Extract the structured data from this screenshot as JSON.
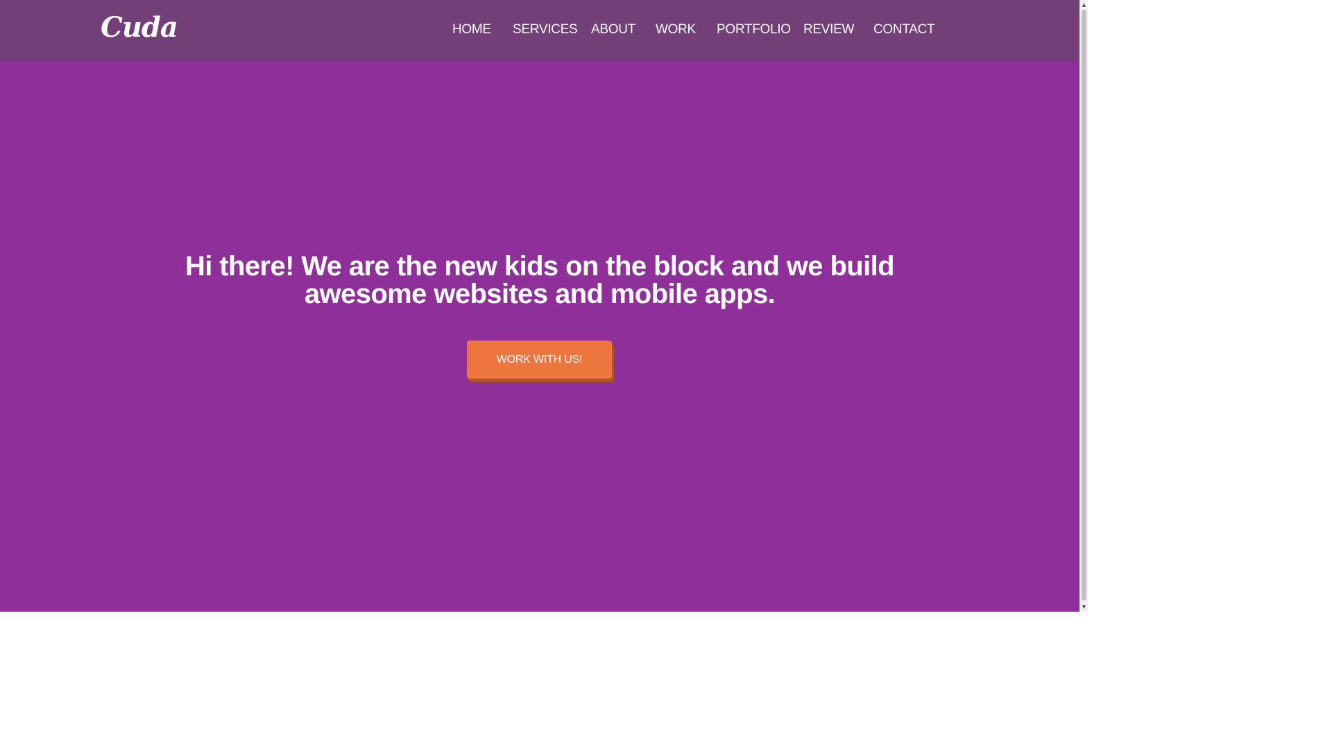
{
  "brand": {
    "logo_text": "Cuda"
  },
  "nav": {
    "items": [
      {
        "label": "HOME"
      },
      {
        "label": "SERVICES"
      },
      {
        "label": "ABOUT"
      },
      {
        "label": "WORK"
      },
      {
        "label": "PORTFOLIO"
      },
      {
        "label": "REVIEW"
      },
      {
        "label": "CONTACT"
      }
    ]
  },
  "hero": {
    "headline_line1": "Hi there! We are the new kids on the block and we build",
    "headline_line2": "awesome websites and mobile apps.",
    "cta_label": "WORK WITH US!"
  },
  "scrollbar": {
    "up_arrow": "▲",
    "down_arrow": "▼"
  },
  "colors": {
    "page_background": "#8f2f99",
    "navbar_background": "#733f78",
    "cta_background": "#ed763f",
    "cta_shadow": "#b3531f",
    "text": "#ffffff"
  }
}
